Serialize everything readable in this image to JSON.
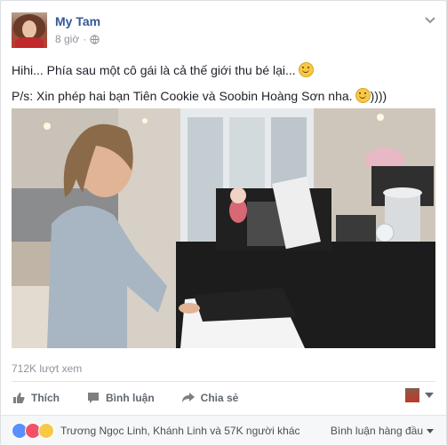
{
  "post": {
    "author": "My Tam",
    "time": "8 giờ",
    "text_line1": "Hihi... Phía sau một cô gái là cả thế giới thu bé lại...",
    "text_line2": "P/s: Xin phép hai bạn Tiên Cookie và Soobin Hoàng Sơn nha.",
    "text_line2_suffix": "))))"
  },
  "video": {
    "views": "712K lượt xem"
  },
  "actions": {
    "like": "Thích",
    "comment": "Bình luận",
    "share": "Chia sẻ"
  },
  "reactions": {
    "summary": "Trương Ngọc Linh, Khánh Linh và 57K người khác",
    "sort_label": "Bình luận hàng đầu"
  },
  "icons": [
    "globe-icon",
    "chevron-down-icon",
    "like-icon",
    "comment-icon",
    "share-icon",
    "smile-emoji-icon"
  ],
  "colors": {
    "link": "#365899",
    "muted": "#90949c",
    "like_blue": "#5890ff",
    "love_red": "#f25268"
  }
}
